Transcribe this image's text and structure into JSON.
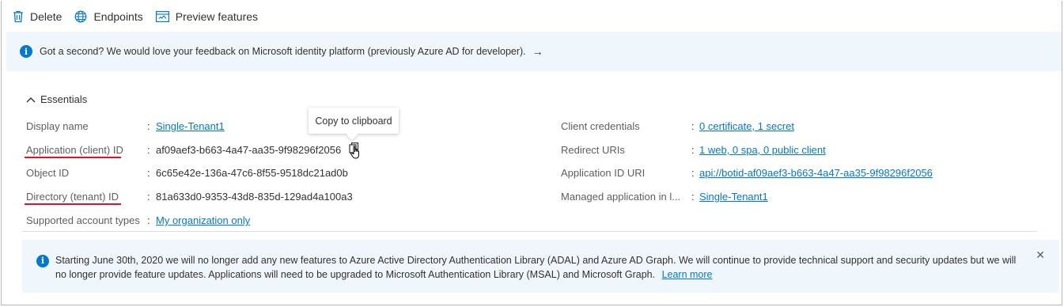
{
  "toolbar": {
    "delete_label": "Delete",
    "endpoints_label": "Endpoints",
    "preview_label": "Preview features"
  },
  "feedback": {
    "text": "Got a second? We would love your feedback on Microsoft identity platform (previously Azure AD for developer).",
    "arrow": "→"
  },
  "essentials": {
    "title": "Essentials",
    "left": [
      {
        "label": "Display name",
        "value": "Single-Tenant1"
      },
      {
        "label": "Application (client) ID",
        "value": "af09aef3-b663-4a47-aa35-9f98296f2056"
      },
      {
        "label": "Object ID",
        "value": "6c65e42e-136a-47c6-8f55-9518dc21ad0b"
      },
      {
        "label": "Directory (tenant) ID",
        "value": "81a633d0-9353-43d8-835d-129ad4a100a3"
      },
      {
        "label": "Supported account types",
        "value": "My organization only"
      }
    ],
    "right": [
      {
        "label": "Client credentials",
        "value": "0 certificate, 1 secret"
      },
      {
        "label": "Redirect URIs",
        "value": "1 web, 0 spa, 0 public client"
      },
      {
        "label": "Application ID URI",
        "value": "api://botid-af09aef3-b663-4a47-aa35-9f98296f2056"
      },
      {
        "label": "Managed application in l...",
        "value": "Single-Tenant1"
      }
    ],
    "colon": ":"
  },
  "tooltip": "Copy to clipboard",
  "notice": {
    "text": "Starting June 30th, 2020 we will no longer add any new features to Azure Active Directory Authentication Library (ADAL) and Azure AD Graph. We will continue to provide technical support and security updates but we will no longer provide feature updates. Applications will need to be upgraded to Microsoft Authentication Library (MSAL) and Microsoft Graph.",
    "link": "Learn more",
    "close": "✕"
  },
  "colors": {
    "accent": "#0078d4",
    "highlight": "#e81123",
    "banner": "#eff6fc"
  }
}
